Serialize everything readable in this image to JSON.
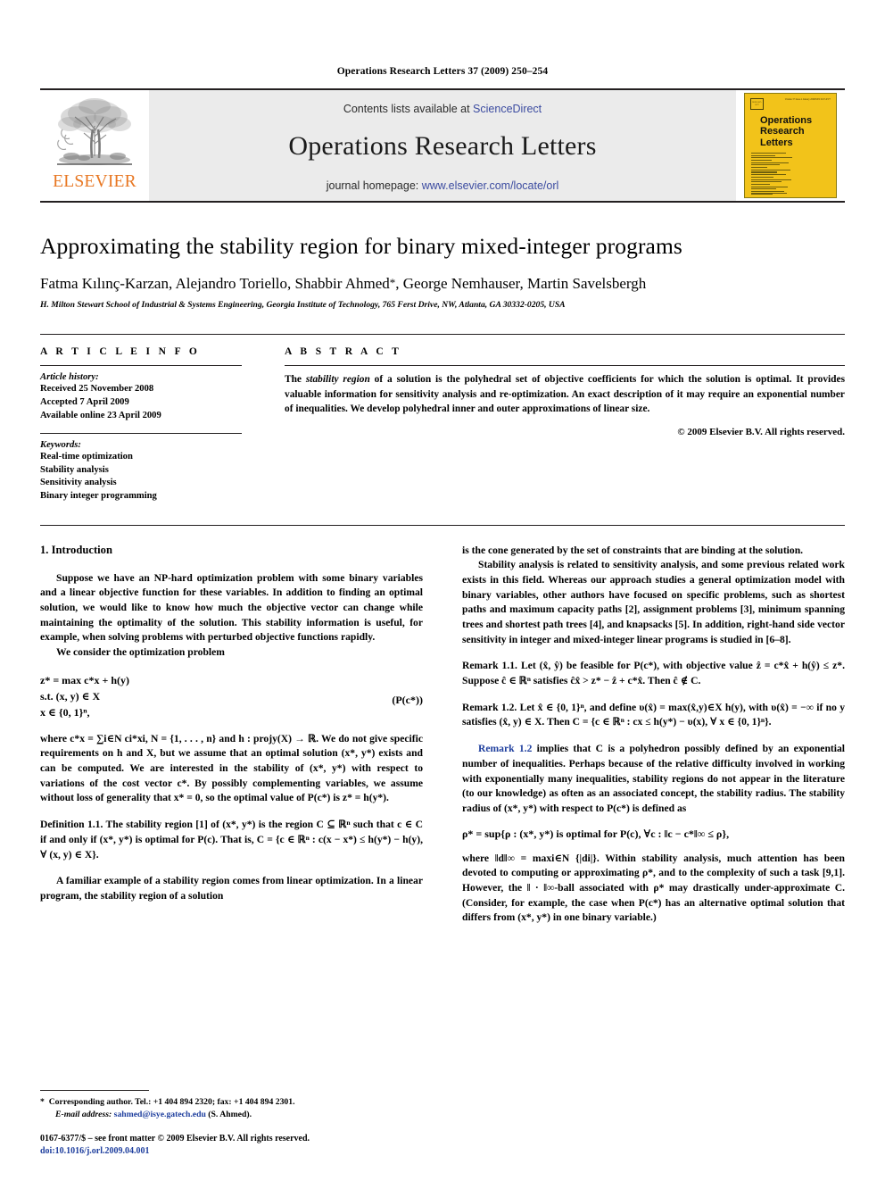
{
  "running_head": "Operations Research Letters 37 (2009) 250–254",
  "banner": {
    "publisher_word": "ELSEVIER",
    "contents_prefix": "Contents lists available at ",
    "contents_link": "ScienceDirect",
    "journal_name": "Operations Research Letters",
    "homepage_prefix": "journal homepage: ",
    "homepage_link": "www.elsevier.com/locate/orl",
    "cover": {
      "issn_box": "ISSN 0167-6377",
      "volume_line": "Volume 37 Issue 4  January 2009",
      "issn_right": "ISSN 0167-6377",
      "title_line1": "Operations",
      "title_line2": "Research",
      "title_line3": "Letters"
    }
  },
  "article": {
    "title": "Approximating the stability region for binary mixed-integer programs",
    "authors": "Fatma Kılınç-Karzan, Alejandro Toriello, Shabbir Ahmed",
    "authors_tail": ", George Nemhauser, Martin Savelsbergh",
    "corresponding_marker": "*",
    "affiliation": "H. Milton Stewart School of Industrial & Systems Engineering, Georgia Institute of Technology, 765 Ferst Drive, NW, Atlanta, GA 30332-0205, USA"
  },
  "info": {
    "heading": "A R T I C L E    I N F O",
    "history_label": "Article history:",
    "history": [
      "Received 25 November 2008",
      "Accepted 7 April 2009",
      "Available online 23 April 2009"
    ],
    "keywords_label": "Keywords:",
    "keywords": [
      "Real-time optimization",
      "Stability analysis",
      "Sensitivity analysis",
      "Binary integer programming"
    ]
  },
  "abstract": {
    "heading": "A B S T R A C T",
    "lead": "The ",
    "emph": "stability region",
    "text": " of a solution is the polyhedral set of objective coefficients for which the solution is optimal. It provides valuable information for sensitivity analysis and re-optimization. An exact description of it may require an exponential number of inequalities. We develop polyhedral inner and outer approximations of linear size.",
    "copyright": "© 2009 Elsevier B.V. All rights reserved."
  },
  "body": {
    "section1_heading": "1. Introduction",
    "left": {
      "p1": "Suppose we have an NP-hard optimization problem with some binary variables and a linear objective function for these variables. In addition to finding an optimal solution, we would like to know how much the objective vector can change while maintaining the optimality of the solution. This stability information is useful, for example, when solving problems with perturbed objective functions rapidly.",
      "p2": "We consider the optimization problem",
      "eq_line1": "z* = max c*x + h(y)",
      "eq_line2": "s.t. (x, y) ∈ X",
      "eq_line3": "x ∈ {0, 1}ⁿ,",
      "eq_tag": "(P(c*))",
      "p3_a": "where ",
      "p3": "where c*x = ∑i∈N ci*xi, N = {1, . . . , n} and h : projy(X) → ℝ. We do not give specific requirements on h and X, but we assume that an optimal solution (x*, y*) exists and can be computed. We are interested in the stability of (x*, y*) with respect to variations of the cost vector c*. By possibly complementing variables, we assume without loss of generality that x* = 0, so the optimal value of P(c*) is z* = h(y*).",
      "def_label": "Definition 1.1.",
      "def_text": " The stability region [1] of (x*, y*) is the region C ⊆ ℝⁿ such that c ∈ C if and only if (x*, y*) is optimal for P(c). That is, C = {c ∈ ℝⁿ : c(x − x*) ≤ h(y*) − h(y), ∀ (x, y) ∈ X}.",
      "def_emph": "stability region",
      "def_ref": "[1]",
      "p4": "A familiar example of a stability region comes from linear optimization. In a linear program, the stability region of a solution"
    },
    "right": {
      "p1": "is the cone generated by the set of constraints that are binding at the solution.",
      "p2": "Stability analysis is related to sensitivity analysis, and some previous related work exists in this field. Whereas our approach studies a general optimization model with binary variables, other authors have focused on specific problems, such as shortest paths and maximum capacity paths [2], assignment problems [3], minimum spanning trees and shortest path trees [4], and knapsacks [5]. In addition, right-hand side vector sensitivity in integer and mixed-integer linear programs is studied in [6–8].",
      "remark11_label": "Remark 1.1.",
      "remark11_text": " Let (x̂, ŷ) be feasible for P(c*), with objective value ẑ = c*x̂ + h(ŷ) ≤ z*. Suppose ĉ ∈ ℝⁿ satisfies ĉx̂ > z* − ẑ + c*x̂. Then ĉ ∉ C.",
      "remark12_label": "Remark 1.2.",
      "remark12_text": " Let x̂ ∈ {0, 1}ⁿ, and define υ(x̂) = max(x̂,y)∈X h(y), with υ(x̂) = −∞ if no y satisfies (x̂, y) ∈ X. Then C = {c ∈ ℝⁿ : cx ≤ h(y*) − υ(x), ∀ x ∈ {0, 1}ⁿ}.",
      "p3_ref": "Remark 1.2",
      "p3": " implies that C is a polyhedron possibly defined by an exponential number of inequalities. Perhaps because of the relative difficulty involved in working with exponentially many inequalities, stability regions do not appear in the literature (to our knowledge) as often as an associated concept, the stability radius. The stability radius of (x*, y*) with respect to P(c*) is defined as",
      "p3_emph": "stability radius",
      "eq_rho": "ρ* = sup{ρ : (x*, y*) is optimal for P(c), ∀c : ‖c − c*‖∞ ≤ ρ},",
      "p4": "where ‖d‖∞ = maxi∈N {|di|}. Within stability analysis, much attention has been devoted to computing or approximating ρ*, and to the complexity of such a task [9,1]. However, the ‖ · ‖∞-ball associated with ρ* may drastically under-approximate C. (Consider, for example, the case when P(c*) has an alternative optimal solution that differs from (x*, y*) in one binary variable.)",
      "p4_refs": "[9,1]"
    }
  },
  "footnote": {
    "star": "*",
    "corresponding": "Corresponding author. Tel.: +1 404 894 2320; fax: +1 404 894 2301.",
    "email_label": "E-mail address:",
    "email": "sahmed@isye.gatech.edu",
    "email_suffix": " (S. Ahmed).",
    "imprint": "0167-6377/$ – see front matter © 2009 Elsevier B.V. All rights reserved.",
    "doi": "doi:10.1016/j.orl.2009.04.001"
  },
  "colors": {
    "link": "#3b4ba0",
    "reference": "#1f3f9e",
    "elsevier_orange": "#e87722",
    "cover_yellow": "#f2c31a",
    "banner_gray": "#ebebeb"
  }
}
